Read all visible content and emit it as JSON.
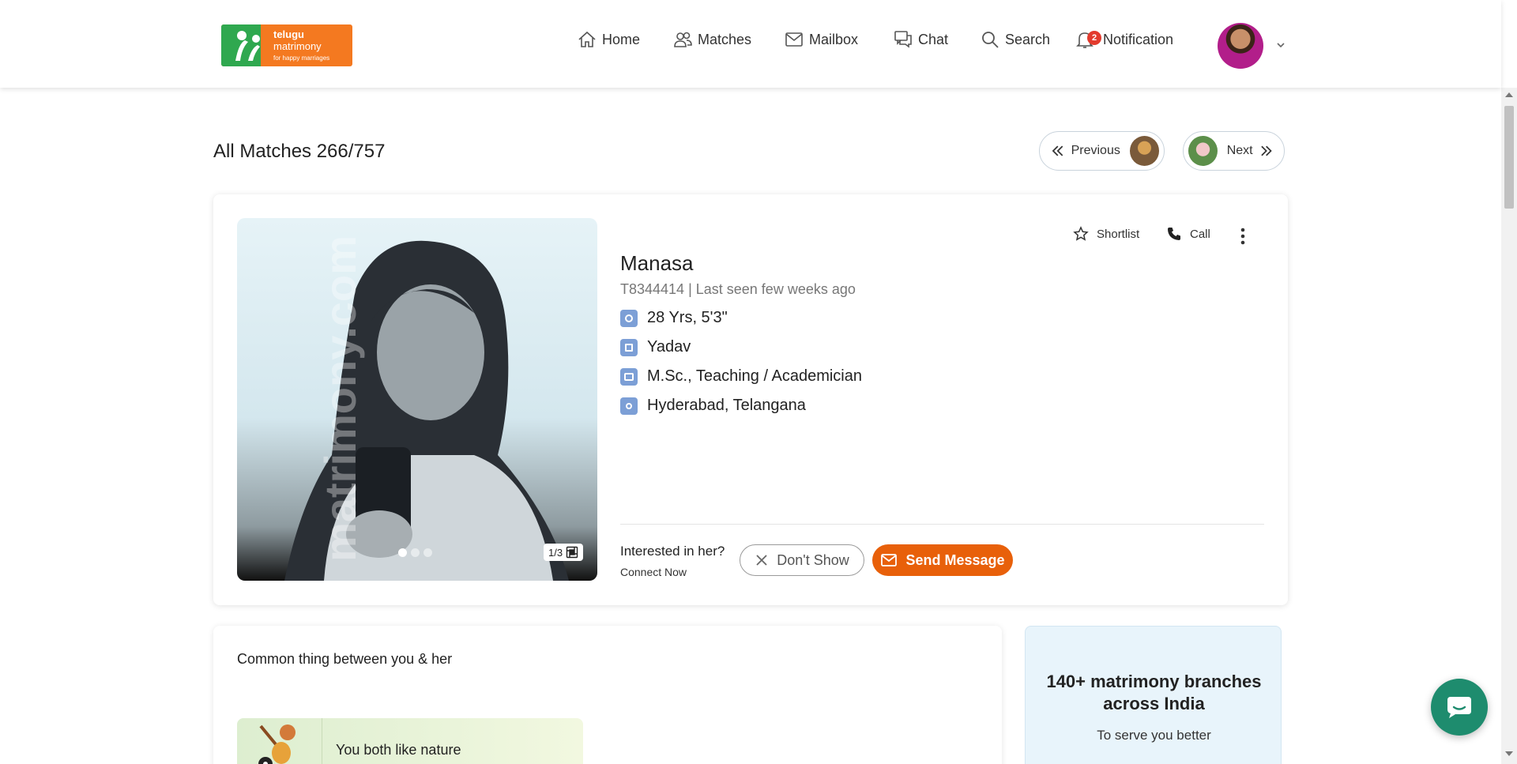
{
  "header": {
    "logo": {
      "line1": "telugu",
      "line2": "matrimony",
      "tagline": "for happy marriages"
    },
    "nav": [
      {
        "label": "Home",
        "icon": "home-icon"
      },
      {
        "label": "Matches",
        "icon": "users-icon"
      },
      {
        "label": "Mailbox",
        "icon": "mail-icon"
      },
      {
        "label": "Chat",
        "icon": "chat-bubbles-icon"
      },
      {
        "label": "Search",
        "icon": "search-icon"
      },
      {
        "label": "Notification",
        "icon": "bell-icon",
        "badge": "2"
      }
    ]
  },
  "page": {
    "title": "All Matches 266/757",
    "previous_label": "Previous",
    "next_label": "Next"
  },
  "profile": {
    "name": "Manasa",
    "id_line": "T8344414 | Last seen few weeks ago",
    "details": [
      {
        "icon": "age-height-icon",
        "text": "28 Yrs, 5'3\""
      },
      {
        "icon": "caste-icon",
        "text": "Yadav"
      },
      {
        "icon": "education-icon",
        "text": "M.Sc., Teaching / Academician"
      },
      {
        "icon": "location-icon",
        "text": "Hyderabad, Telangana"
      }
    ],
    "photo": {
      "count": "1/3",
      "watermark": "matrimony.com",
      "slides": 3,
      "active_slide": 1
    },
    "actions": {
      "shortlist": "Shortlist",
      "call": "Call"
    },
    "interest": {
      "question": "Interested in her?",
      "connect": "Connect Now",
      "dont_show": "Don't Show",
      "send_message": "Send Message"
    }
  },
  "common": {
    "title": "Common thing between you & her",
    "item": "You both like nature"
  },
  "branches": {
    "title": "140+ matrimony branches across India",
    "subtitle": "To serve you better"
  },
  "colors": {
    "brand_orange": "#f47920",
    "brand_green": "#2fa84f",
    "send_button": "#e8600a",
    "chat_fab": "#1e8c6e"
  }
}
